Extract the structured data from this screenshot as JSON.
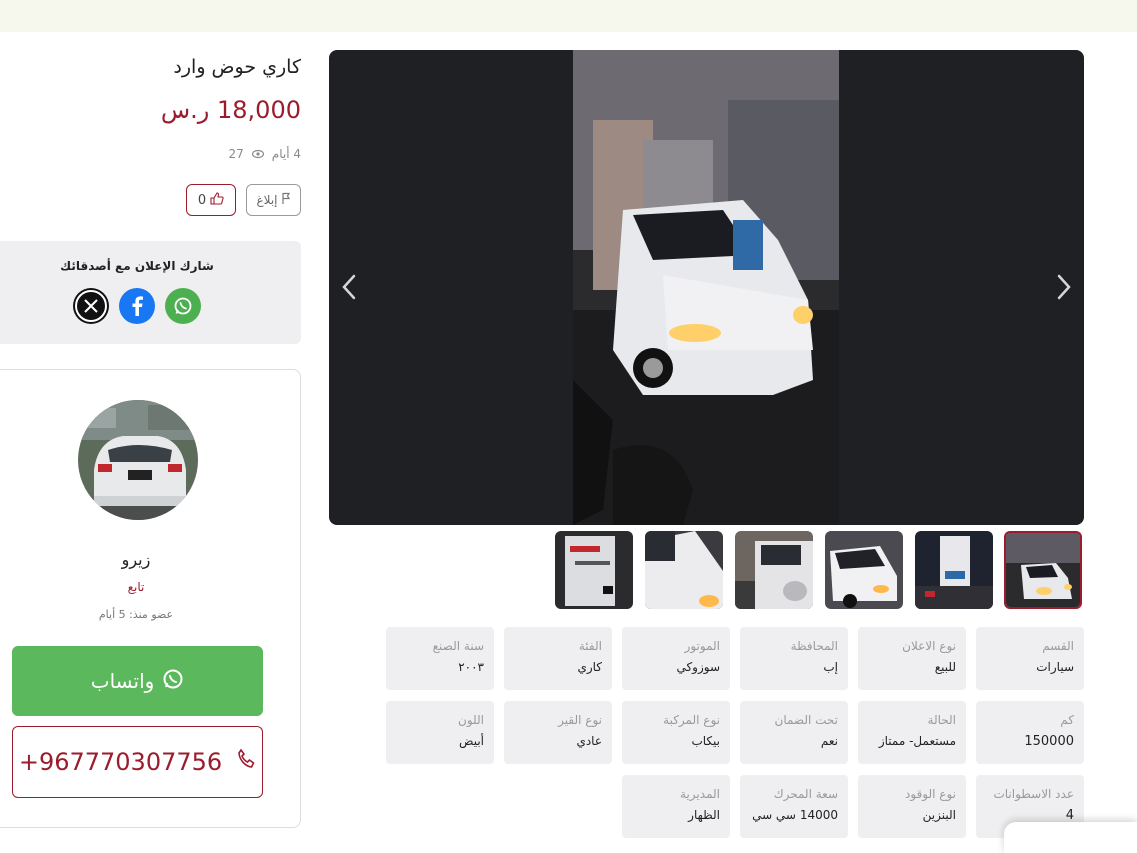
{
  "listing": {
    "title": "كاري حوض وارد",
    "price": "18,000 ر.س",
    "age": "4 أيام",
    "views": "27",
    "report_label": "إبلاغ",
    "likes": "0"
  },
  "share": {
    "title": "شارك الإعلان مع أصدقائك",
    "networks": [
      "x-icon",
      "facebook-icon",
      "whatsapp-icon"
    ]
  },
  "seller": {
    "name": "زيرو",
    "follow_label": "تابع",
    "member_since": "عضو منذ: 5 أيام",
    "whatsapp_label": "واتساب",
    "phone": "+967770307756"
  },
  "specs": [
    {
      "key": "القسم",
      "value": "سيارات"
    },
    {
      "key": "نوع الاعلان",
      "value": "للبيع"
    },
    {
      "key": "المحافظة",
      "value": "إب"
    },
    {
      "key": "الموتور",
      "value": "سوزوكي"
    },
    {
      "key": "الفئة",
      "value": "كاري"
    },
    {
      "key": "سنة الصنع",
      "value": "٢٠٠٣"
    },
    {
      "key": "كم",
      "value": "150000"
    },
    {
      "key": "الحالة",
      "value": "مستعمل- ممتاز"
    },
    {
      "key": "تحت الضمان",
      "value": "نعم"
    },
    {
      "key": "نوع المركبة",
      "value": "بيكاب"
    },
    {
      "key": "نوع القير",
      "value": "عادي"
    },
    {
      "key": "اللون",
      "value": "أبيض"
    },
    {
      "key": "عدد الاسطوانات",
      "value": "4"
    },
    {
      "key": "نوع الوقود",
      "value": "البنزين"
    },
    {
      "key": "سعة المحرك",
      "value": "14000 سي سي"
    },
    {
      "key": "المديرية",
      "value": "الظهار"
    }
  ],
  "colors": {
    "accent": "#9b1c2c",
    "whatsapp": "#5cb85c",
    "card": "#efeff1",
    "gallery": "#1f2023"
  }
}
